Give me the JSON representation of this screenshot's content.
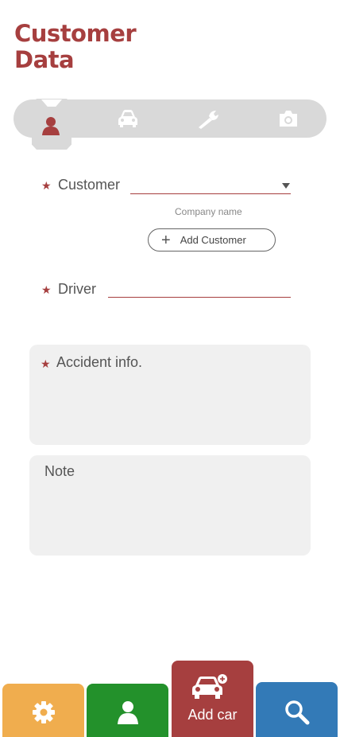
{
  "header": {
    "title_line1": "Customer",
    "title_line2": "Data"
  },
  "steps": [
    {
      "icon": "person-icon",
      "active": true
    },
    {
      "icon": "car-icon",
      "active": false
    },
    {
      "icon": "wrench-icon",
      "active": false
    },
    {
      "icon": "camera-icon",
      "active": false
    }
  ],
  "form": {
    "customer": {
      "label": "Customer",
      "value": "",
      "hint": "Company name",
      "required": true
    },
    "add_customer_label": "Add Customer",
    "driver": {
      "label": "Driver",
      "value": "",
      "required": true
    },
    "accident_info": {
      "label": "Accident info.",
      "value": "",
      "required": true
    },
    "note": {
      "label": "Note",
      "value": ""
    }
  },
  "bottom_bar": {
    "settings": {
      "icon": "gear-icon"
    },
    "profile": {
      "icon": "person-icon"
    },
    "add_car": {
      "icon": "car-plus-icon",
      "label": "Add car"
    },
    "search": {
      "icon": "search-icon"
    }
  },
  "colors": {
    "brand": "#a63f3f",
    "settings": "#f0ad4e",
    "profile": "#23912b",
    "search": "#337ab7",
    "tab_bg": "#d9d9d9",
    "input_bg": "#f0f0f0"
  }
}
